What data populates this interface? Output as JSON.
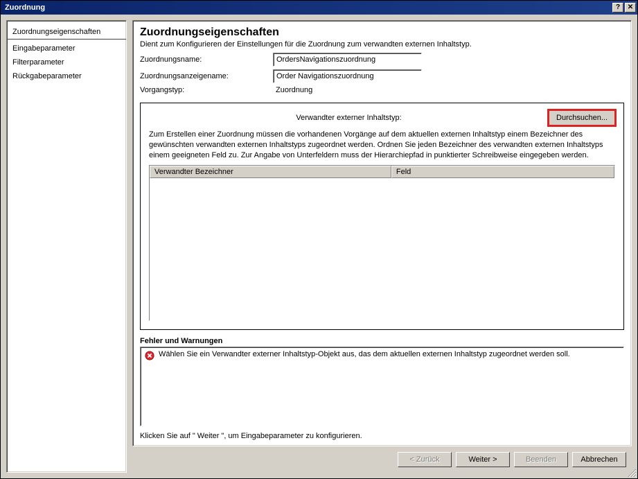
{
  "window": {
    "title": "Zuordnung"
  },
  "sidebar": {
    "items": [
      {
        "label": "Zuordnungseigenschaften",
        "selected": true
      },
      {
        "label": "Eingabeparameter",
        "selected": false
      },
      {
        "label": "Filterparameter",
        "selected": false
      },
      {
        "label": "Rückgabeparameter",
        "selected": false
      }
    ]
  },
  "page": {
    "heading": "Zuordnungseigenschaften",
    "description": "Dient zum Konfigurieren der Einstellungen für die Zuordnung zum verwandten externen Inhaltstyp.",
    "fields": {
      "name_label": "Zuordnungsname:",
      "name_value": "OrdersNavigationszuordnung",
      "displayname_label": "Zuordnungsanzeigename:",
      "displayname_value": "Order Navigationszuordnung",
      "optype_label": "Vorgangstyp:",
      "optype_value": "Zuordnung"
    },
    "related": {
      "label": "Verwandter externer Inhaltstyp:",
      "browse_button": "Durchsuchen...",
      "description": "Zum Erstellen einer Zuordnung müssen die vorhandenen Vorgänge auf dem aktuellen externen Inhaltstyp einem Bezeichner des gewünschten verwandten externen Inhaltstyps zugeordnet werden. Ordnen Sie jeden Bezeichner des verwandten externen Inhaltstyps einem geeigneten Feld zu. Zur Angabe von Unterfeldern muss der Hierarchiepfad in punktierter Schreibweise eingegeben werden.",
      "col1": "Verwandter Bezeichner",
      "col2": "Feld"
    },
    "errors": {
      "heading": "Fehler und Warnungen",
      "items": [
        {
          "icon": "error",
          "text": "Wählen Sie ein Verwandter externer Inhaltstyp-Objekt aus, das dem aktuellen externen Inhaltstyp zugeordnet werden soll."
        }
      ]
    },
    "hint": "Klicken Sie auf \" Weiter \", um Eingabeparameter zu konfigurieren."
  },
  "footer": {
    "back": "< Zurück",
    "next": "Weiter >",
    "finish": "Beenden",
    "cancel": "Abbrechen"
  }
}
